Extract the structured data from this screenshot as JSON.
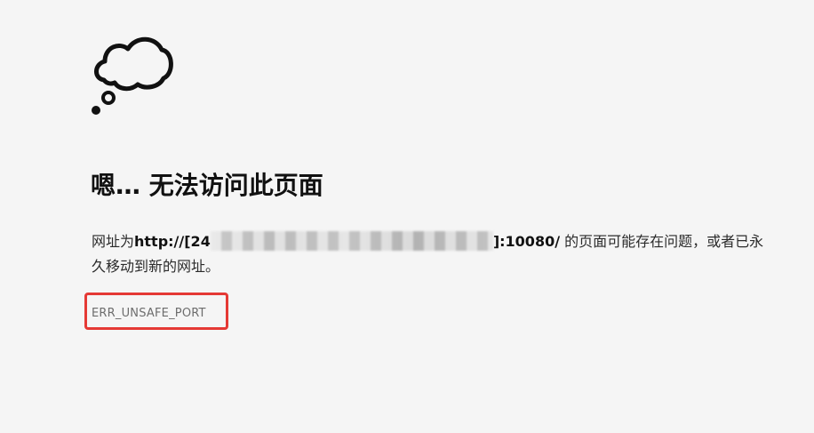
{
  "page": {
    "icon": "thought-bubble-icon",
    "title": "嗯… 无法访问此页面",
    "message_prefix": "网址为",
    "url_start": "http://[24",
    "url_redacted": "redacted-address",
    "url_end": "]:10080/",
    "message_suffix": " 的页面可能存在问题，或者已永久移动到新的网址。",
    "error_code": "ERR_UNSAFE_PORT"
  },
  "colors": {
    "background": "#f5f5f5",
    "text": "#111111",
    "error_code": "#6d6d6d",
    "highlight": "#e53935"
  }
}
